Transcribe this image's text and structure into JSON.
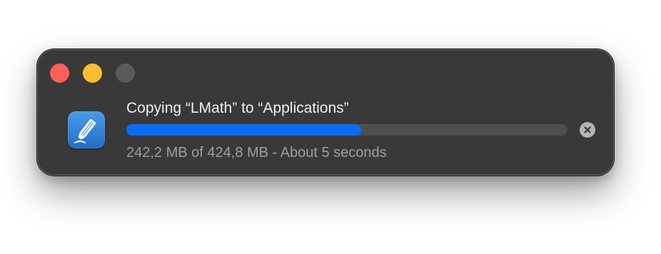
{
  "window": {
    "controls": {
      "close_color": "#ff5f57",
      "minimize_color": "#febc2e",
      "zoom_color": "#5a5a5a"
    }
  },
  "copy": {
    "app_icon": "lmath-pencil-icon",
    "title": "Copying “LMath” to “Applications”",
    "progress": 0.533,
    "progress_color": "#0a6cf5",
    "status": "242,2 MB of 424,8 MB - About 5 seconds",
    "cancel_icon": "cancel-x-circle-icon"
  }
}
